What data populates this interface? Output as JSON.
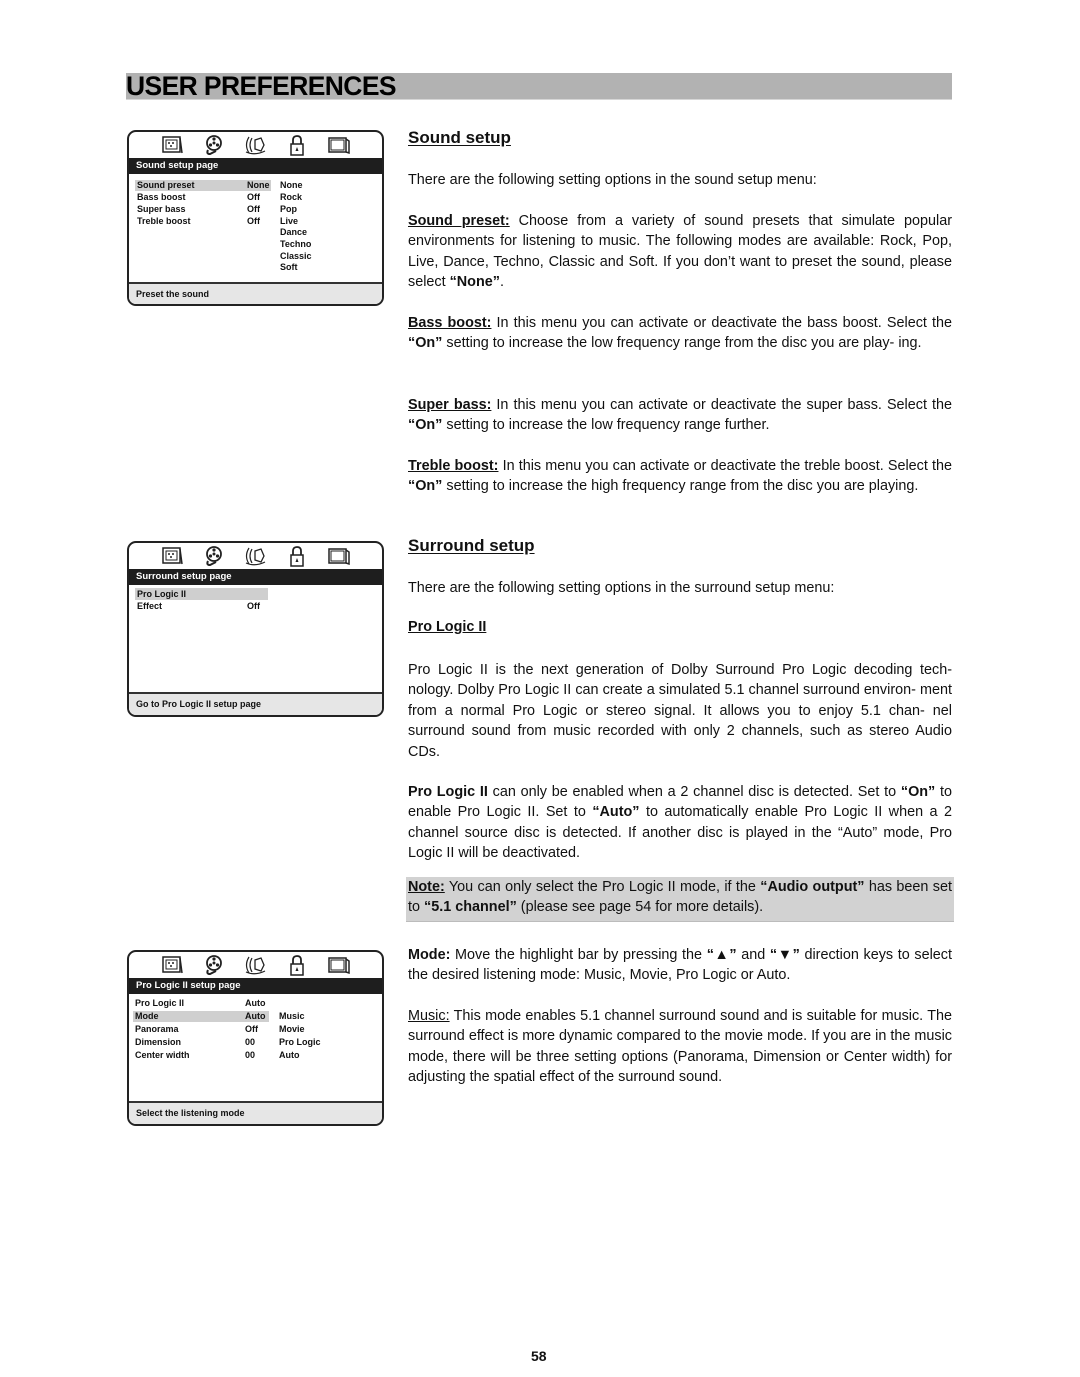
{
  "header": {
    "title": "USER PREFERENCES"
  },
  "osd_icons": [
    "photo-settings-icon",
    "film-reel-icon",
    "speaker-sound-icon",
    "padlock-icon",
    "tv-screen-icon"
  ],
  "menus": [
    {
      "title": "Sound setup page",
      "rows": [
        {
          "label": "Sound preset",
          "value": "None",
          "highlighted": true
        },
        {
          "label": "Bass boost",
          "value": "Off",
          "highlighted": false
        },
        {
          "label": "Super bass",
          "value": "Off",
          "highlighted": false
        },
        {
          "label": "Treble boost",
          "value": "Off",
          "highlighted": false
        }
      ],
      "options": [
        "None",
        "Rock",
        "Pop",
        "Live",
        "Dance",
        "Techno",
        "Classic",
        "Soft"
      ],
      "status": "Preset the sound"
    },
    {
      "title": "Surround setup page",
      "rows": [
        {
          "label": "Pro Logic II",
          "value": "",
          "highlighted": true
        },
        {
          "label": "Effect",
          "value": "Off",
          "highlighted": false
        }
      ],
      "options": [],
      "status": "Go to Pro Logic II setup page"
    },
    {
      "title": "Pro Logic II setup page",
      "rows": [
        {
          "label": "Pro Logic II",
          "value": "Auto",
          "highlighted": false
        },
        {
          "label": "Mode",
          "value": "Auto",
          "highlighted": true
        },
        {
          "label": "Panorama",
          "value": "Off",
          "highlighted": false
        },
        {
          "label": "Dimension",
          "value": "00",
          "highlighted": false
        },
        {
          "label": "Center width",
          "value": "00",
          "highlighted": false
        }
      ],
      "options": [
        "Music",
        "Movie",
        "Pro Logic",
        "Auto"
      ],
      "status": "Select the listening mode"
    }
  ],
  "sound_setup": {
    "heading": "Sound setup",
    "intro": "There are the following setting options in the sound setup menu:",
    "sound_preset_label": "Sound preset:",
    "sound_preset_text": " Choose from a variety of sound presets that simulate popular environments for listening to music. The following modes are available: Rock, Pop, Live, Dance, Techno, Classic and Soft. If you don’t want to preset the sound, please select ",
    "sound_preset_none": "“None”",
    "sound_preset_end": ".",
    "bass_boost_label": "Bass boost:",
    "bass_boost_text1": " In this menu you can activate or deactivate the bass boost. Select the ",
    "bass_boost_on": "“On”",
    "bass_boost_text2": " setting to increase the low frequency range from the disc you are play- ing.",
    "super_bass_label": "Super bass:",
    "super_bass_text1": " In this menu you can activate or deactivate the super bass. Select the ",
    "super_bass_on": "“On”",
    "super_bass_text2": " setting to increase the low frequency range further.",
    "treble_boost_label": "Treble boost:",
    "treble_boost_text1": " In this menu you can activate or deactivate the treble boost. Select the ",
    "treble_boost_on": "“On”",
    "treble_boost_text2": " setting to increase the high frequency range from the disc you are playing."
  },
  "surround_setup": {
    "heading": "Surround setup",
    "intro": "There are the following setting options in the surround setup menu:",
    "pro_logic_heading": "Pro Logic II",
    "pro_logic_desc": "Pro Logic II is the next generation of Dolby Surround Pro Logic decoding tech- nology. Dolby Pro Logic II can create a simulated 5.1 channel surround environ- ment from a normal Pro Logic or stereo signal. It allows you to enjoy 5.1 chan- nel surround sound from music recorded with only 2 channels, such as stereo Audio CDs.",
    "enable_bold": "Pro Logic II",
    "enable_text1": " can only be enabled when a 2 channel disc is detected. Set to ",
    "enable_on": "“On”",
    "enable_text2": " to enable Pro Logic II. Set to ",
    "enable_auto": "“Auto”",
    "enable_text3": " to automatically enable Pro Logic II when a 2 channel source disc is detected. If another disc is played in the “Auto” mode, Pro Logic II will be deactivated.",
    "note_label": "Note:",
    "note_text1": " You can only select the Pro Logic II mode, if the ",
    "note_audio_output": "“Audio output”",
    "note_text2": " has been set to ",
    "note_channel": "“5.1 channel”",
    "note_text3": " (please see page 54 for more details).",
    "mode_label": "Mode:",
    "mode_text1": " Move the highlight bar by pressing the ",
    "mode_up": "“▲”",
    "mode_and": " and ",
    "mode_down": "“▼”",
    "mode_text2": " direction keys to select the desired listening mode: Music, Movie, Pro Logic or Auto.",
    "music_label": "Music:",
    "music_text": " This mode enables 5.1 channel surround sound and is suitable for music. The surround effect is more dynamic compared to the movie mode. If you are in the music mode, there will be three setting options (Panorama, Dimension or Center width) for adjusting the spatial effect of the surround sound."
  },
  "page_number": "58"
}
